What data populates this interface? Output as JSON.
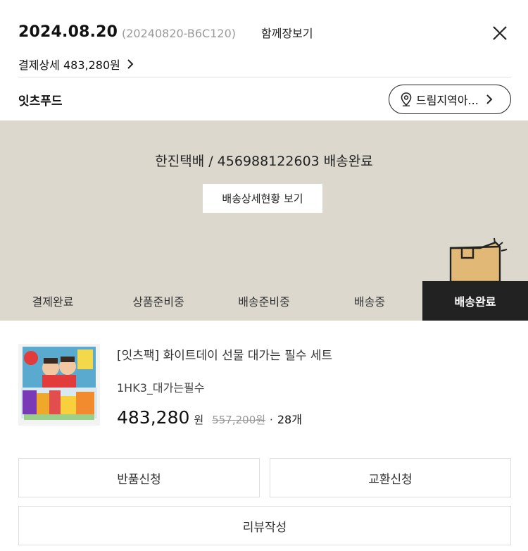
{
  "header": {
    "date": "2024.08.20",
    "order_id": "(20240820-B6C120)",
    "together_label": "함께장보기",
    "pay_detail_label": "결제상세 483,280원",
    "store_name": "잇츠푸드",
    "region_label": "드림지역아..."
  },
  "delivery": {
    "status_text": "한진택배 / 456988122603 배송완료",
    "detail_button": "배송상세현황 보기"
  },
  "tabs": [
    {
      "label": "결제완료",
      "active": false
    },
    {
      "label": "상품준비중",
      "active": false
    },
    {
      "label": "배송준비중",
      "active": false
    },
    {
      "label": "배송중",
      "active": false
    },
    {
      "label": "배송완료",
      "active": true
    }
  ],
  "product": {
    "name": "[잇츠팩] 화이트데이 선물 대가는 필수 세트",
    "option": "1HK3_대가는필수",
    "price": "483,280",
    "won": "원",
    "original_price": "557,200원",
    "separator": "·",
    "quantity": "28개"
  },
  "actions": {
    "return_label": "반품신청",
    "exchange_label": "교환신청",
    "review_label": "리뷰작성"
  },
  "colors": {
    "delivery_bg": "#dcd8cd",
    "active_tab_bg": "#222222",
    "box_color": "#e2b877"
  }
}
